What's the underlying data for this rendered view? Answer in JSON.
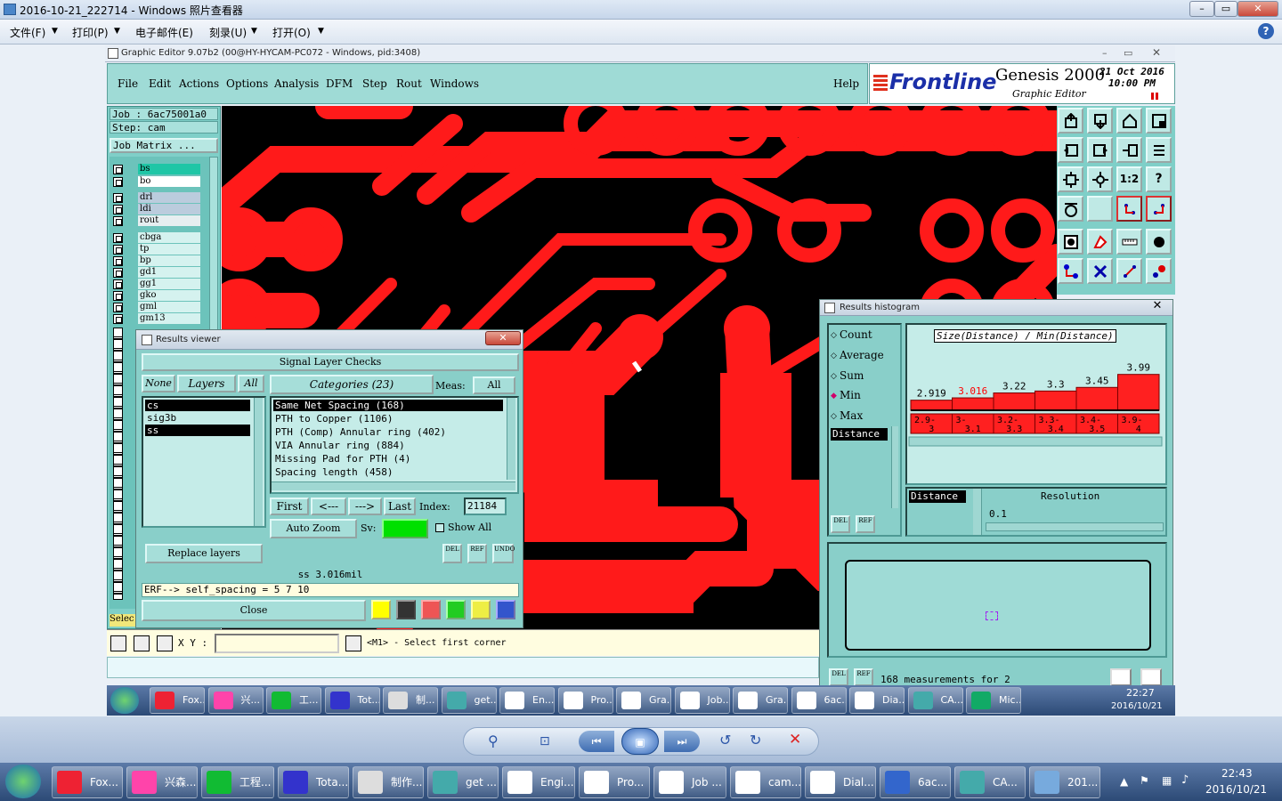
{
  "photo_viewer": {
    "title": "2016-10-21_222714 - Windows 照片查看器",
    "menu": [
      "文件(F)",
      "打印(P)",
      "电子邮件(E)",
      "刻录(U)",
      "打开(O)"
    ],
    "help": "?"
  },
  "genesis": {
    "title": "Graphic Editor 9.07b2 (00@HY-HYCAM-PC072 - Windows, pid:3408)",
    "menu": [
      "File",
      "Edit",
      "Actions",
      "Options",
      "Analysis",
      "DFM",
      "Step",
      "Rout",
      "Windows"
    ],
    "help": "Help",
    "logo": {
      "brand": "Frontline",
      "product": "Genesis 2000",
      "sub": "Graphic Editor",
      "date": "21 Oct 2016",
      "time": "10:00 PM"
    },
    "job": "Job : 6ac75001a0",
    "step": "Step: cam",
    "job_matrix": "Job Matrix ...",
    "layers": [
      "bs",
      "bo",
      "drl",
      "ldi",
      "rout",
      "cbga",
      "tp",
      "bp",
      "gd1",
      "gg1",
      "gko",
      "gml",
      "gm13"
    ],
    "select_label": "Selec",
    "coord_label": "X Y :",
    "coord_value": "",
    "hint": "<M1> - Select first corner"
  },
  "results_viewer": {
    "title": "Results viewer",
    "heading": "Signal Layer Checks",
    "none": "None",
    "layers_label": "Layers",
    "all": "All",
    "categories": "Categories (23)",
    "meas_label": "Meas:",
    "meas_value": "All",
    "layer_list": [
      "cs",
      "sig3b",
      "ss"
    ],
    "category_list": [
      "Same Net Spacing (168)",
      "PTH to Copper (1106)",
      "PTH (Comp) Annular ring (402)",
      "VIA Annular ring (884)",
      "Missing Pad for PTH (4)",
      "Spacing length (458)"
    ],
    "first": "First",
    "prev": "<---",
    "next": "--->",
    "last": "Last",
    "index_label": "Index:",
    "index_value": "21184",
    "auto_zoom": "Auto Zoom",
    "sv_label": "Sv:",
    "show_all": "Show All",
    "replace_layers": "Replace layers",
    "measurement": "ss 3.016mil",
    "erf": "ERF--> self_spacing = 5 7 10",
    "close": "Close",
    "del": "DEL",
    "ref": "REF",
    "undo": "UNDO"
  },
  "histogram": {
    "title": "Results histogram",
    "modes": [
      "Count",
      "Average",
      "Sum",
      "Min",
      "Max"
    ],
    "selected_mode": "Min",
    "field": "Distance",
    "chart_title": "Size(Distance) / Min(Distance)",
    "resolution_label": "Resolution",
    "resolution_field": "Distance",
    "resolution_value": "0.1",
    "footer": "168 measurements for 2",
    "del": "DEL",
    "ref": "REF"
  },
  "chart_data": {
    "type": "bar",
    "title": "Size(Distance) / Min(Distance)",
    "categories": [
      "2.9-3",
      "3-3.1",
      "3.2-3.3",
      "3.3-3.4",
      "3.4-3.5",
      "3.9-4"
    ],
    "values": [
      2.919,
      3.016,
      3.22,
      3.3,
      3.45,
      3.99
    ],
    "highlight_index": 1,
    "colors": {
      "bar": "#ff2020",
      "highlight_label": "#ff0000"
    }
  },
  "inner_taskbar": {
    "items": [
      "Fox...",
      "兴...",
      "工...",
      "Tot...",
      "制...",
      "get...",
      "En...",
      "Pro...",
      "Gra...",
      "Job...",
      "Gra...",
      "6ac...",
      "Dia...",
      "CA...",
      "Mic..."
    ],
    "time": "22:27",
    "date": "2016/10/21"
  },
  "outer_taskbar": {
    "items": [
      "Fox...",
      "兴森...",
      "工程...",
      "Tota...",
      "制作...",
      "get ...",
      "Engi...",
      "Pro...",
      "Job ...",
      "cam...",
      "Dial...",
      "6ac...",
      "CA...",
      "201..."
    ],
    "time": "22:43",
    "date": "2016/10/21"
  }
}
